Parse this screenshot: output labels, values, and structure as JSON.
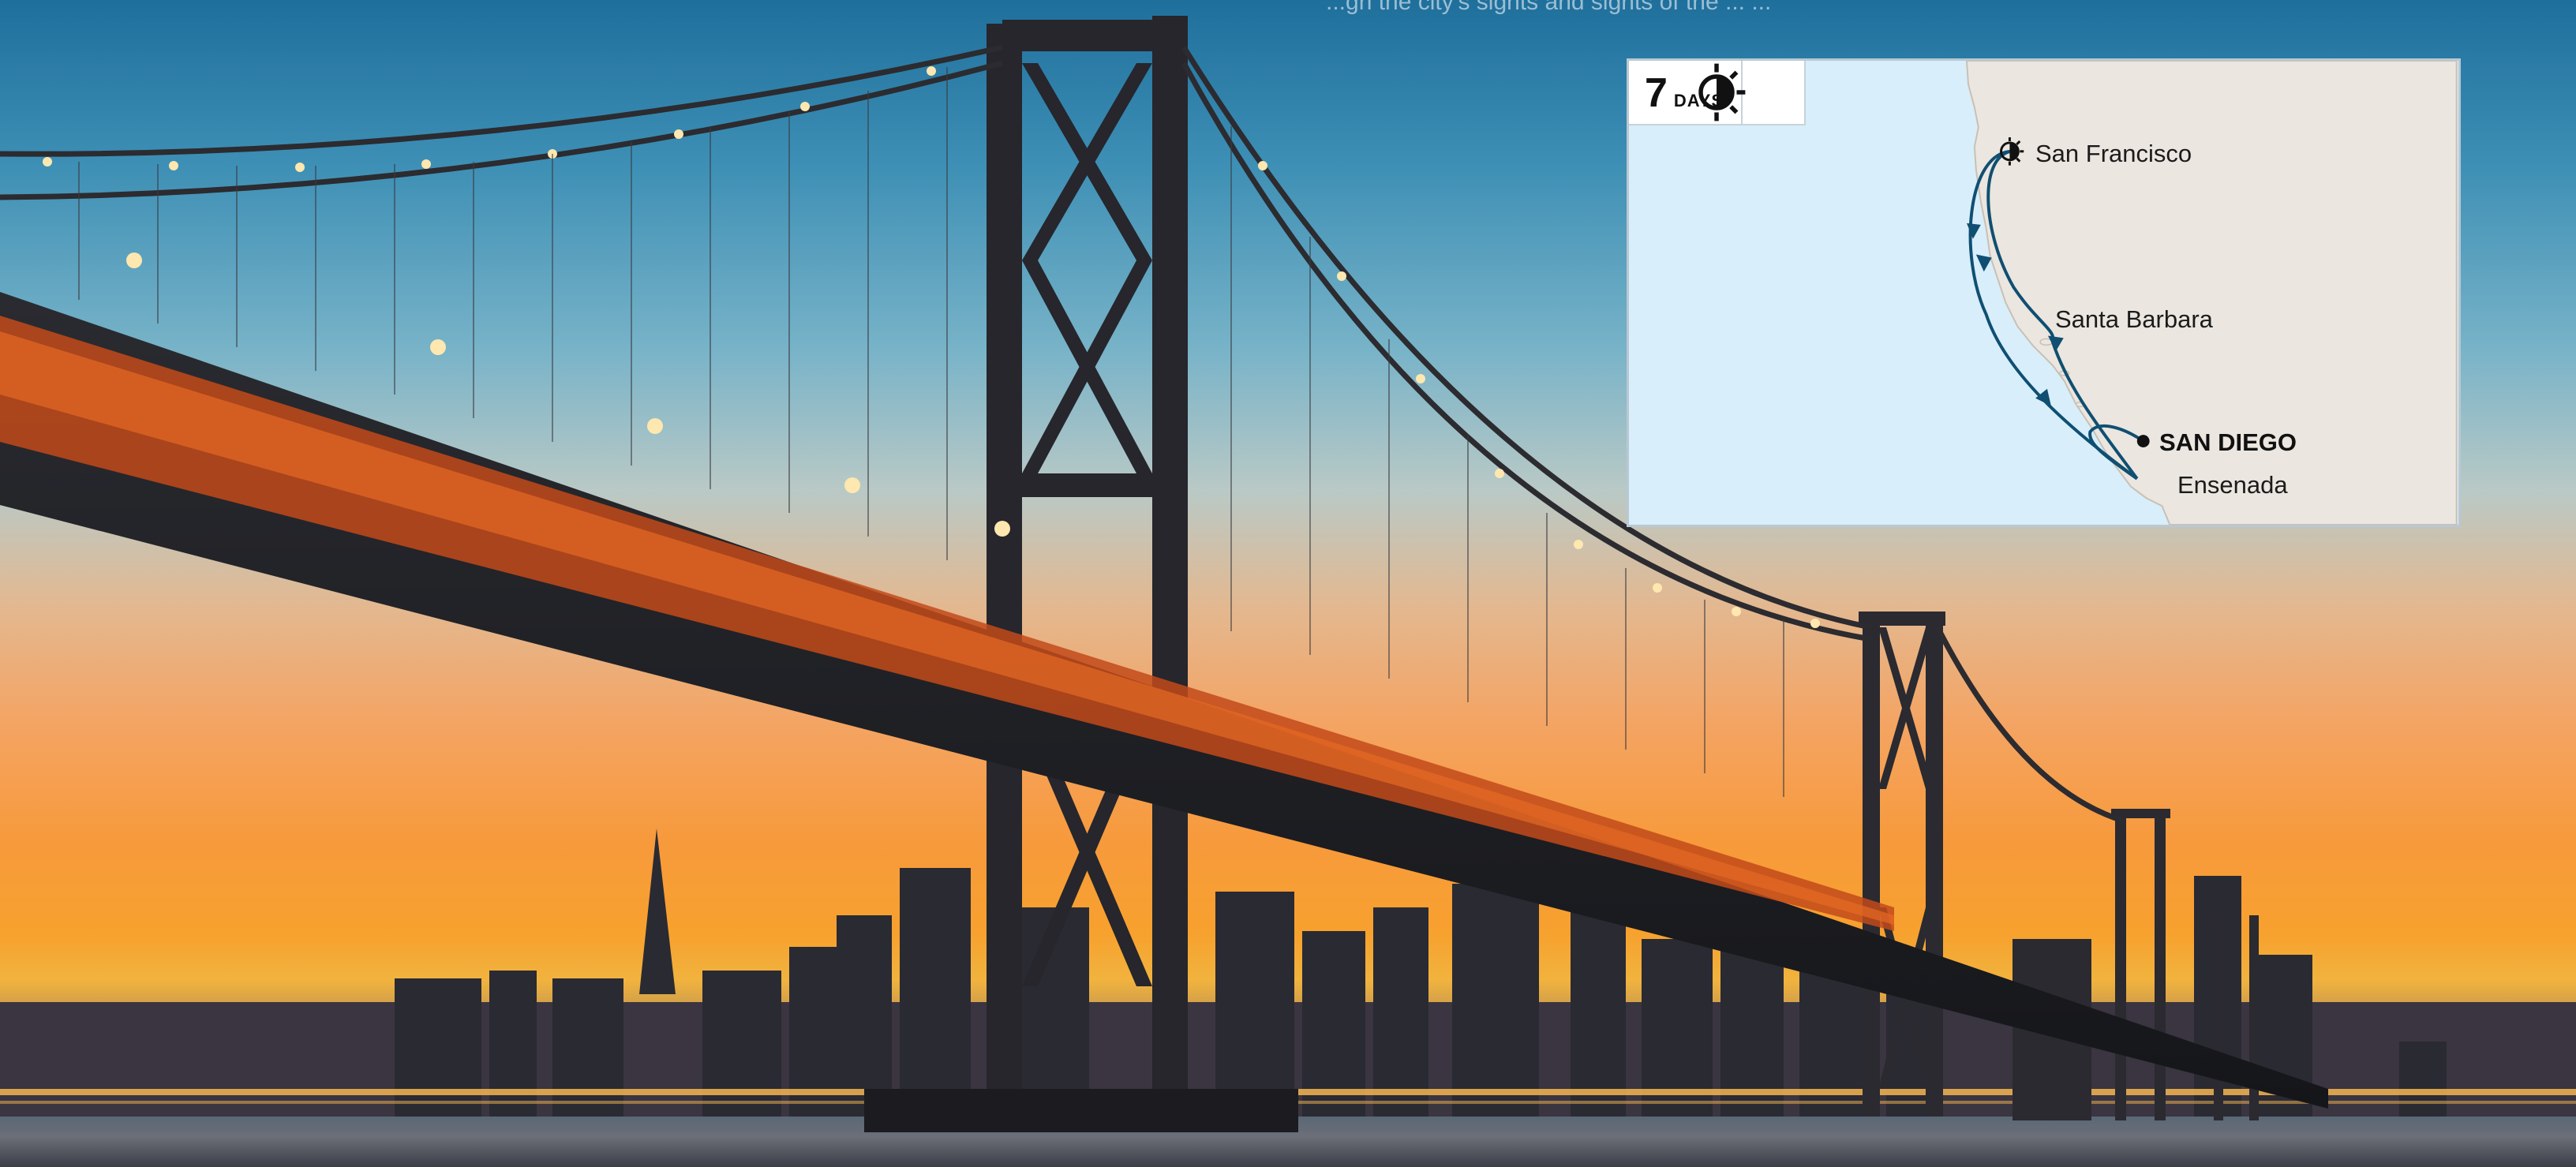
{
  "caption": {
    "partial_text": "...gh the city's sights and sights of the ... ..."
  },
  "itinerary": {
    "duration_number": "7",
    "duration_unit": "DAYS",
    "day_night_icon": "day-night-icon",
    "ports": {
      "san_francisco": "San Francisco",
      "santa_barbara": "Santa Barbara",
      "san_diego": "SAN DIEGO",
      "ensenada": "Ensenada"
    }
  },
  "colors": {
    "route": "#0f4f72",
    "land": "#ebe6df",
    "sea": "#d8eefa",
    "sky_top": "#1f6f9c",
    "sunset": "#f79a3c"
  }
}
